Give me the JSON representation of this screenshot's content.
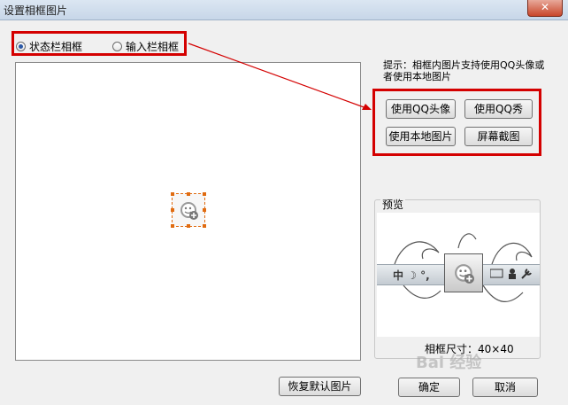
{
  "window": {
    "title": "设置相框图片",
    "close_symbol": "✕"
  },
  "frame_type": {
    "options": [
      {
        "label": "状态栏相框",
        "selected": true
      },
      {
        "label": "输入栏相框",
        "selected": false
      }
    ]
  },
  "hint": "提示：相框内图片支持使用QQ头像或者使用本地图片",
  "source_buttons": {
    "use_qq_avatar": "使用QQ头像",
    "use_qq_show": "使用QQ秀",
    "use_local_image": "使用本地图片",
    "screenshot": "屏幕截图"
  },
  "preview": {
    "title": "预览",
    "bar_text": "中 ☽ °,",
    "size_label": "相框尺寸：40×40"
  },
  "buttons": {
    "restore_default": "恢复默认图片",
    "ok": "确定",
    "cancel": "取消"
  },
  "watermark": "Bai 经验",
  "colors": {
    "highlight": "#d40000",
    "handle": "#e06b10"
  }
}
